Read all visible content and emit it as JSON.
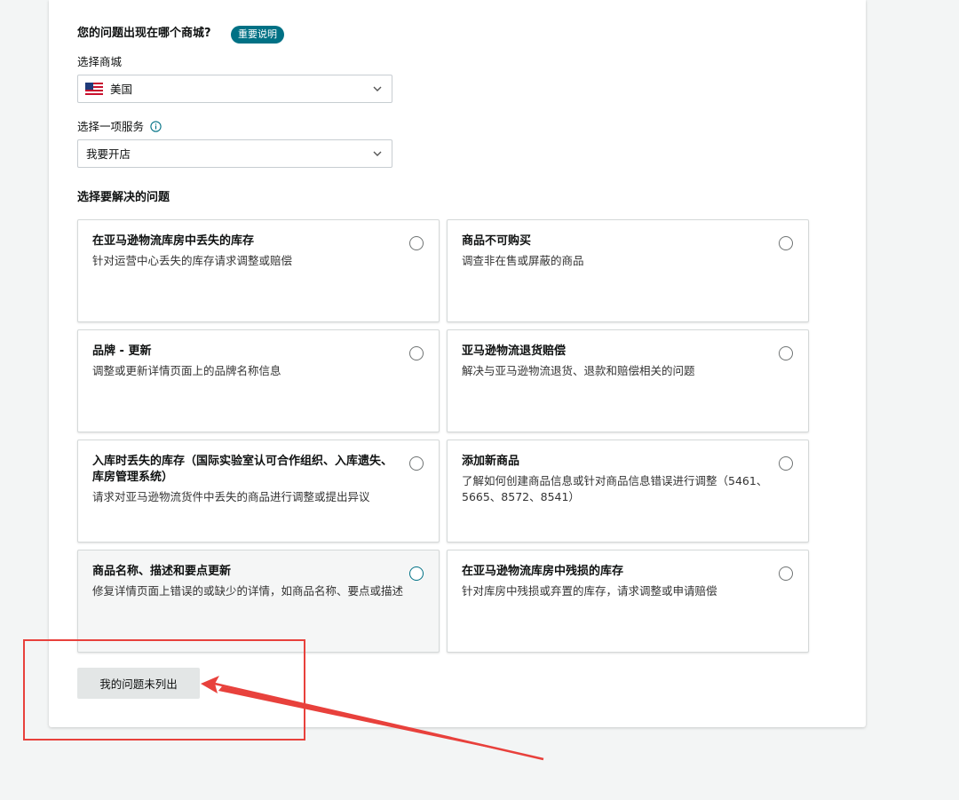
{
  "question": {
    "title": "您的问题出现在哪个商城?",
    "badge": "重要说明"
  },
  "marketplace": {
    "label": "选择商城",
    "value": "美国",
    "flag_icon": "us-flag-icon"
  },
  "service": {
    "label": "选择一项服务",
    "value": "我要开店",
    "info_icon": "info-icon"
  },
  "issues": {
    "title": "选择要解决的问题",
    "cards": [
      {
        "title": "在亚马逊物流库房中丢失的库存",
        "desc": "针对运营中心丢失的库存请求调整或赔偿"
      },
      {
        "title": "商品不可购买",
        "desc": "调查非在售或屏蔽的商品"
      },
      {
        "title": "品牌 - 更新",
        "desc": "调整或更新详情页面上的品牌名称信息"
      },
      {
        "title": "亚马逊物流退货赔偿",
        "desc": "解决与亚马逊物流退货、退款和赔偿相关的问题"
      },
      {
        "title": "入库时丢失的库存（国际实验室认可合作组织、入库遗失、库房管理系统）",
        "desc": "请求对亚马逊物流货件中丢失的商品进行调整或提出异议"
      },
      {
        "title": "添加新商品",
        "desc": "了解如何创建商品信息或针对商品信息错误进行调整（5461、5665、8572、8541）"
      },
      {
        "title": "商品名称、描述和要点更新",
        "desc": "修复详情页面上错误的或缺少的详情，如商品名称、要点或描述"
      },
      {
        "title": "在亚马逊物流库房中残损的库存",
        "desc": "针对库房中残损或弃置的库存，请求调整或申请赔偿"
      }
    ]
  },
  "not_listed_button": "我的问题未列出",
  "colors": {
    "accent": "#007185",
    "annotation": "#e8413c"
  }
}
